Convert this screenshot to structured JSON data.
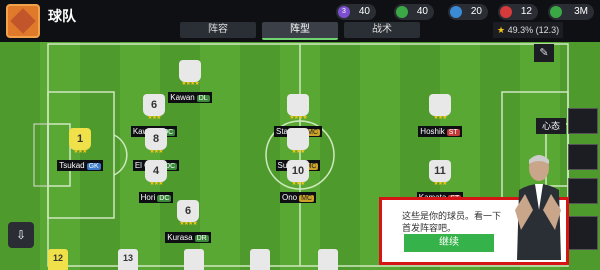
{
  "header": {
    "title": "球队",
    "resources": [
      {
        "label": "40",
        "color": "#f5c518"
      },
      {
        "label": "40",
        "color": "#3aa845"
      },
      {
        "label": "20",
        "color": "#3a8ad6"
      },
      {
        "label": "12",
        "color": "#d63a3a"
      },
      {
        "label": "3M",
        "color": "#3aa845"
      }
    ],
    "level": "3"
  },
  "tabs": [
    {
      "label": "阵容"
    },
    {
      "label": "阵型"
    },
    {
      "label": "战术"
    }
  ],
  "rating": {
    "text": "49.3% (12.3)"
  },
  "mentality": "心态",
  "players": [
    {
      "name": "Kawan",
      "pos": "DL",
      "num": "",
      "cls": "dl"
    },
    {
      "name": "Kawahi",
      "pos": "DC",
      "num": "6",
      "cls": "dc"
    },
    {
      "name": "Tsukad",
      "pos": "GK",
      "num": "1",
      "cls": "gk"
    },
    {
      "name": "El Ouni",
      "pos": "DC",
      "num": "8",
      "cls": "dc"
    },
    {
      "name": "Hori",
      "pos": "DC",
      "num": "4",
      "cls": "dc"
    },
    {
      "name": "Kurasa",
      "pos": "DR",
      "num": "6",
      "cls": "dc"
    },
    {
      "name": "Stanoje",
      "pos": "MC",
      "num": "",
      "cls": "mc"
    },
    {
      "name": "Suzuki",
      "pos": "MC",
      "num": "",
      "cls": "mc"
    },
    {
      "name": "Ono",
      "pos": "MC",
      "num": "10",
      "cls": "mc"
    },
    {
      "name": "Hoshik",
      "pos": "ST",
      "num": "",
      "cls": "st"
    },
    {
      "name": "Kamata",
      "pos": "ST",
      "num": "11",
      "cls": "st"
    }
  ],
  "bench": [
    "12",
    "13",
    "",
    "",
    "",
    "",
    ""
  ],
  "dialog": {
    "text": "这些是你的球员。看一下首发阵容吧。",
    "continue_label": "继续"
  }
}
